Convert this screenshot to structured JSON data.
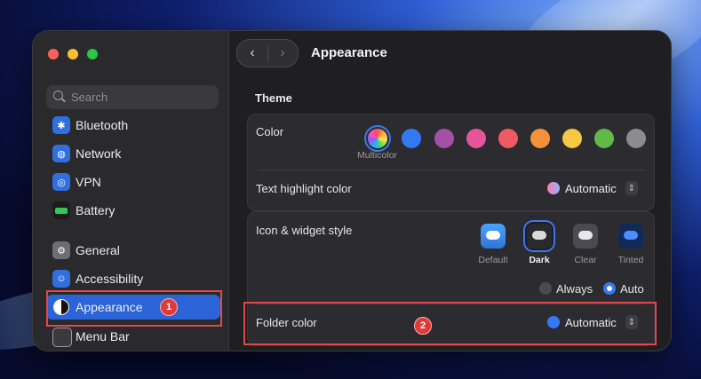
{
  "window": {
    "title": "Appearance",
    "nav_back": "‹",
    "nav_forward": "›"
  },
  "sidebar": {
    "search_placeholder": "Search",
    "items": [
      {
        "label": "Bluetooth",
        "icon": "bluetooth-icon",
        "color": "#2f6fde"
      },
      {
        "label": "Network",
        "icon": "globe-icon",
        "color": "#2f6fde"
      },
      {
        "label": "VPN",
        "icon": "vpn-icon",
        "color": "#2f6fde"
      },
      {
        "label": "Battery",
        "icon": "battery-icon",
        "color": "#34c759"
      },
      {
        "label": "General",
        "icon": "gear-icon",
        "color": "#8e8e93"
      },
      {
        "label": "Accessibility",
        "icon": "accessibility-icon",
        "color": "#2f6fde"
      },
      {
        "label": "Appearance",
        "icon": "appearance-icon",
        "color": "#1c1c1e"
      },
      {
        "label": "Menu Bar",
        "icon": "menubar-icon",
        "color": "#3a3a3e"
      }
    ],
    "selected": "Appearance"
  },
  "theme": {
    "section_title": "Theme",
    "color_label": "Color",
    "accent_colors": [
      "#multicolor",
      "#3478f6",
      "#a550a7",
      "#e8549a",
      "#ee5a5f",
      "#f5913a",
      "#f6c843",
      "#62ba46",
      "#8c8c8c"
    ],
    "selected_accent_label": "Multicolor",
    "highlight_label": "Text highlight color",
    "highlight_value": "Automatic"
  },
  "widget": {
    "label": "Icon & widget style",
    "styles": [
      "Default",
      "Dark",
      "Clear",
      "Tinted"
    ],
    "selected_style": "Dark",
    "modes": [
      "Always",
      "Auto"
    ],
    "selected_mode": "Auto"
  },
  "folder": {
    "label": "Folder color",
    "value": "Automatic",
    "color": "#3478f6"
  },
  "annotations": {
    "badge1": "1",
    "badge2": "2",
    "highlight_color": "#e2474a"
  }
}
